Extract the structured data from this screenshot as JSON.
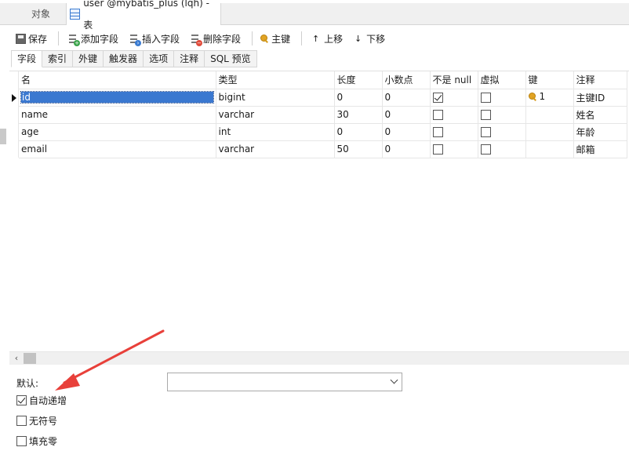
{
  "object_tabs": {
    "objects_label": "对象",
    "table_tab_label": "user @mybatis_plus (lqh) - 表"
  },
  "toolbar": {
    "save": "保存",
    "add_field": "添加字段",
    "insert_field": "插入字段",
    "delete_field": "删除字段",
    "primary_key": "主键",
    "move_up": "上移",
    "move_down": "下移"
  },
  "sub_tabs": [
    "字段",
    "索引",
    "外键",
    "触发器",
    "选项",
    "注释",
    "SQL 预览"
  ],
  "grid": {
    "columns": [
      "名",
      "类型",
      "长度",
      "小数点",
      "不是 null",
      "虚拟",
      "键",
      "注释"
    ],
    "rows": [
      {
        "name": "id",
        "type": "bigint",
        "length": "0",
        "decimals": "0",
        "not_null": true,
        "virtual": false,
        "key": "1",
        "comment": "主键ID"
      },
      {
        "name": "name",
        "type": "varchar",
        "length": "30",
        "decimals": "0",
        "not_null": false,
        "virtual": false,
        "key": "",
        "comment": "姓名"
      },
      {
        "name": "age",
        "type": "int",
        "length": "0",
        "decimals": "0",
        "not_null": false,
        "virtual": false,
        "key": "",
        "comment": "年龄"
      },
      {
        "name": "email",
        "type": "varchar",
        "length": "50",
        "decimals": "0",
        "not_null": false,
        "virtual": false,
        "key": "",
        "comment": "邮箱"
      }
    ]
  },
  "properties": {
    "default_label": "默认:",
    "default_value": "",
    "auto_increment_label": "自动递增",
    "auto_increment_checked": true,
    "unsigned_label": "无符号",
    "unsigned_checked": false,
    "zerofill_label": "填充零",
    "zerofill_checked": false
  },
  "colors": {
    "selection": "#3a78d0",
    "annotation_arrow": "#e8403a",
    "key_icon": "#e2a425"
  }
}
